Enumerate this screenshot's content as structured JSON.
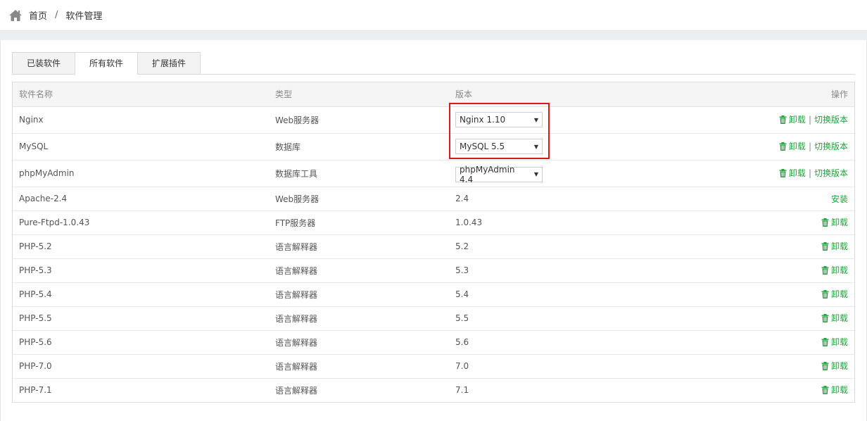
{
  "breadcrumb": {
    "home": "首页",
    "separator": "/",
    "current": "软件管理"
  },
  "tabs": [
    {
      "label": "已装软件",
      "active": false
    },
    {
      "label": "所有软件",
      "active": true
    },
    {
      "label": "扩展插件",
      "active": false
    }
  ],
  "table": {
    "headers": {
      "name": "软件名称",
      "type": "类型",
      "version": "版本",
      "actions": "操作"
    },
    "rows": [
      {
        "name": "Nginx",
        "type": "Web服务器",
        "version": "Nginx 1.10",
        "select": true,
        "uninstall": "卸载",
        "switch": "切换版本"
      },
      {
        "name": "MySQL",
        "type": "数据库",
        "version": "MySQL 5.5",
        "select": true,
        "uninstall": "卸载",
        "switch": "切换版本"
      },
      {
        "name": "phpMyAdmin",
        "type": "数据库工具",
        "version": "phpMyAdmin 4.4",
        "select": true,
        "uninstall": "卸载",
        "switch": "切换版本"
      },
      {
        "name": "Apache-2.4",
        "type": "Web服务器",
        "version": "2.4",
        "select": false,
        "install": "安装"
      },
      {
        "name": "Pure-Ftpd-1.0.43",
        "type": "FTP服务器",
        "version": "1.0.43",
        "select": false,
        "uninstall": "卸载"
      },
      {
        "name": "PHP-5.2",
        "type": "语言解释器",
        "version": "5.2",
        "select": false,
        "uninstall": "卸载"
      },
      {
        "name": "PHP-5.3",
        "type": "语言解释器",
        "version": "5.3",
        "select": false,
        "uninstall": "卸载"
      },
      {
        "name": "PHP-5.4",
        "type": "语言解释器",
        "version": "5.4",
        "select": false,
        "uninstall": "卸载"
      },
      {
        "name": "PHP-5.5",
        "type": "语言解释器",
        "version": "5.5",
        "select": false,
        "uninstall": "卸载"
      },
      {
        "name": "PHP-5.6",
        "type": "语言解释器",
        "version": "5.6",
        "select": false,
        "uninstall": "卸载"
      },
      {
        "name": "PHP-7.0",
        "type": "语言解释器",
        "version": "7.0",
        "select": false,
        "uninstall": "卸载"
      },
      {
        "name": "PHP-7.1",
        "type": "语言解释器",
        "version": "7.1",
        "select": false,
        "uninstall": "卸载"
      }
    ]
  },
  "colors": {
    "accent_green": "#20a53a",
    "highlight_red": "#d9191c"
  }
}
